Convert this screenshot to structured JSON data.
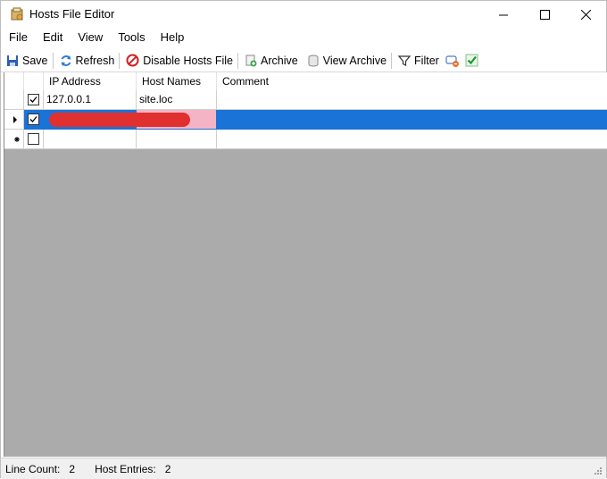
{
  "window": {
    "title": "Hosts File Editor"
  },
  "menu": [
    "File",
    "Edit",
    "View",
    "Tools",
    "Help"
  ],
  "toolbar": {
    "save": "Save",
    "refresh": "Refresh",
    "disable": "Disable Hosts File",
    "archive": "Archive",
    "view_archive": "View Archive",
    "filter": "Filter"
  },
  "grid": {
    "columns": [
      "IP Address",
      "Host Names",
      "Comment"
    ],
    "rows": [
      {
        "enabled": true,
        "ip": "127.0.0.1",
        "host": "site.loc",
        "comment": ""
      },
      {
        "enabled": true,
        "ip": "",
        "host": "",
        "comment": "",
        "selected": true,
        "redacted": true
      },
      {
        "enabled": false,
        "ip": "",
        "host": "",
        "comment": "",
        "new_row": true
      }
    ]
  },
  "status": {
    "line_count_label": "Line Count:",
    "line_count": "2",
    "host_entries_label": "Host Entries:",
    "host_entries": "2"
  },
  "colors": {
    "selection": "#1a73d6",
    "host_cell_selected": "#f5b4c5",
    "empty_area": "#ababab",
    "redaction": "#e0302f"
  }
}
